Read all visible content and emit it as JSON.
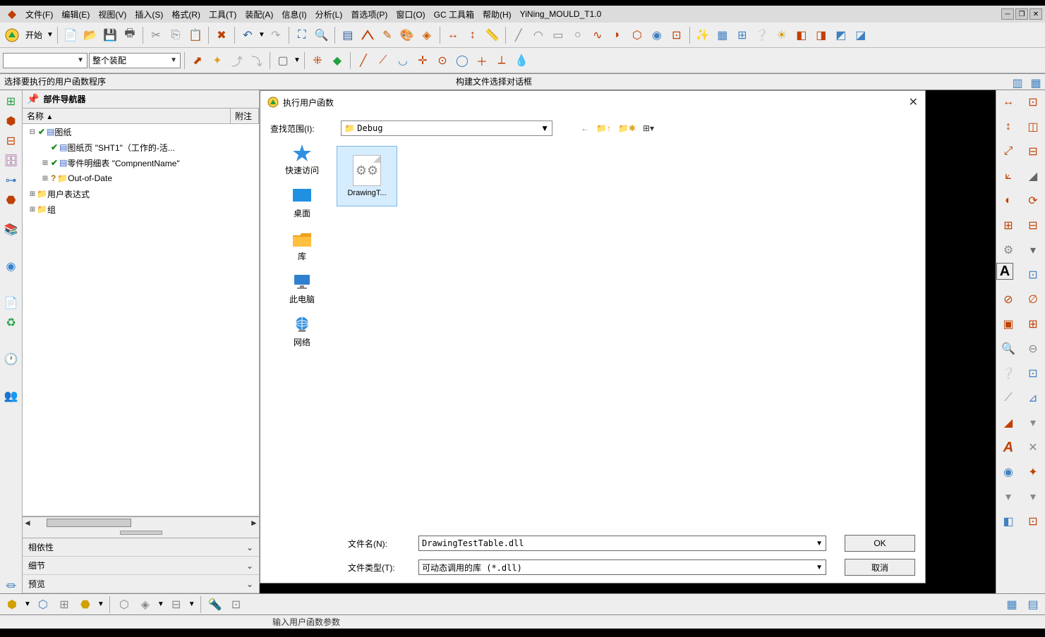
{
  "menu": {
    "items": [
      "文件(F)",
      "编辑(E)",
      "视图(V)",
      "插入(S)",
      "格式(R)",
      "工具(T)",
      "装配(A)",
      "信息(I)",
      "分析(L)",
      "首选项(P)",
      "窗口(O)",
      "GC 工具箱",
      "帮助(H)",
      "YiNing_MOULD_T1.0"
    ]
  },
  "toolbar": {
    "start": "开始",
    "combo2": "整个装配"
  },
  "status": {
    "left": "选择要执行的用户函数程序",
    "right": "构建文件选择对话框"
  },
  "nav": {
    "title": "部件导航器",
    "col1": "名称",
    "col2": "附注",
    "tree": [
      {
        "indent": 0,
        "expander": "⊟",
        "check": true,
        "icon": "doc",
        "label": "图纸"
      },
      {
        "indent": 1,
        "expander": "",
        "check": true,
        "icon": "doc",
        "label": "图纸页 \"SHT1\"（工作的-活..."
      },
      {
        "indent": 1,
        "expander": "⊞",
        "check": true,
        "icon": "doc",
        "label": "零件明细表 \"CompnentName\""
      },
      {
        "indent": 1,
        "expander": "⊞",
        "qmark": true,
        "icon": "folder",
        "label": "Out-of-Date"
      },
      {
        "indent": 0,
        "expander": "⊞",
        "icon": "folder",
        "label": "用户表达式"
      },
      {
        "indent": 0,
        "expander": "⊞",
        "icon": "folder",
        "label": "组"
      }
    ],
    "acc": [
      "相依性",
      "细节",
      "预览"
    ]
  },
  "dialog": {
    "title": "执行用户函数",
    "scope_label": "查找范围(I):",
    "scope_value": "Debug",
    "places": [
      "快速访问",
      "桌面",
      "库",
      "此电脑",
      "网络"
    ],
    "file_item": "DrawingT...",
    "filename_label": "文件名(N):",
    "filename_value": "DrawingTestTable.dll",
    "filetype_label": "文件类型(T):",
    "filetype_value": "可动态调用的库 (*.dll)",
    "ok": "OK",
    "cancel": "取消"
  },
  "status2": "输入用户函数参数"
}
